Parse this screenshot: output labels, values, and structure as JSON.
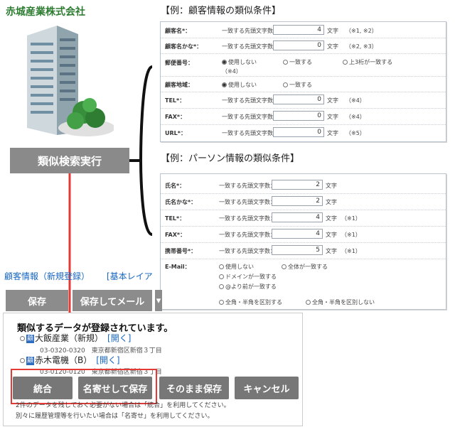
{
  "company": "赤城産業株式会社",
  "run_button": "類似検索実行",
  "customer_section": {
    "title": "【例：顧客情報の類似条件】",
    "rows": [
      {
        "label": "顧客名*：",
        "sub": "一致する先頭文字数：",
        "value": "4",
        "unit": "文字",
        "note": "（※1, ※2）"
      },
      {
        "label": "顧客名かな*：",
        "sub": "一致する先頭文字数：",
        "value": "0",
        "unit": "文字",
        "note": "（※2, ※3）"
      },
      {
        "label": "郵便番号：",
        "opt1": "使用しない",
        "opt2": "一致する",
        "opt3": "上3桁が一致する",
        "note": "（※4）"
      },
      {
        "label": "顧客地域：",
        "opt1": "使用しない",
        "opt2": "一致する"
      },
      {
        "label": "TEL*：",
        "sub": "一致する先頭文字数：",
        "value": "0",
        "unit": "文字",
        "note": "（※4）"
      },
      {
        "label": "FAX*：",
        "sub": "一致する先頭文字数：",
        "value": "0",
        "unit": "文字",
        "note": "（※4）"
      },
      {
        "label": "URL*：",
        "sub": "一致する先頭文字数：",
        "value": "0",
        "unit": "文字",
        "note": "（※5）"
      }
    ]
  },
  "person_section": {
    "title": "【例：パーソン情報の類似条件】",
    "rows": [
      {
        "label": "氏名*：",
        "sub": "一致する先頭文字数：",
        "value": "2",
        "unit": "文字"
      },
      {
        "label": "氏名かな*：",
        "sub": "一致する先頭文字数：",
        "value": "2",
        "unit": "文字"
      },
      {
        "label": "TEL*：",
        "sub": "一致する先頭文字数：",
        "value": "4",
        "unit": "文字",
        "note": "（※1）"
      },
      {
        "label": "FAX*：",
        "sub": "一致する先頭文字数：",
        "value": "4",
        "unit": "文字",
        "note": "（※1）"
      },
      {
        "label": "携帯番号*：",
        "sub": "一致する先頭文字数：",
        "value": "5",
        "unit": "文字",
        "note": "（※1）"
      }
    ],
    "email": {
      "label": "E-Mail：",
      "opt_none": "使用しない",
      "opt_all": "全体が一致する",
      "opt_domain": "ドメインが一致する",
      "opt_before_at": "@より前が一致する",
      "case1": "全角・半角を区別する",
      "case2": "全角・半角を区別しない"
    }
  },
  "form": {
    "link1": "顧客情報（新規登録）",
    "link2": "[基本レイア",
    "save": "保存",
    "save_mail": "保存してメール"
  },
  "dialog": {
    "title": "類似するデータが登録されています。",
    "records": [
      {
        "name": "大飯産業（新規）",
        "open": "[開く]",
        "address": "03-0320-0320　東京都新宿区新宿３丁目"
      },
      {
        "name": "赤木電機（B）",
        "open": "[開く]",
        "address": "03-0120-0120　東京都新宿区新宿３丁目"
      }
    ],
    "buttons": {
      "merge": "統合",
      "namelink": "名寄せして保存",
      "save_as_is": "そのまま保存",
      "cancel": "キャンセル"
    },
    "footer1": "2件のデータを残しておく必要がない場合は「統合」を利用してください。",
    "footer2": "別々に履歴管理等を行いたい場合は「名寄せ」を利用してください。"
  },
  "colors": {
    "company": "#2e7d32",
    "run_button": "#8a8a8a",
    "arrow": "#e53935",
    "link": "#1565c0"
  }
}
